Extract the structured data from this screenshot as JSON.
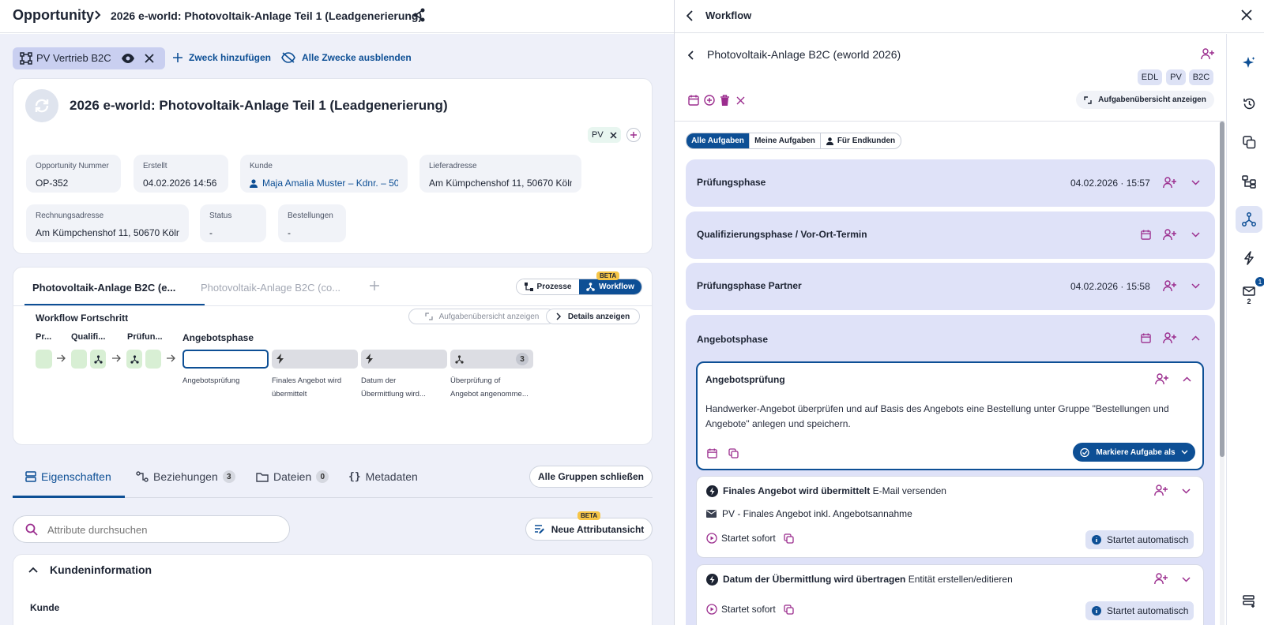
{
  "header": {
    "breadcrumb_root": "Opportunity",
    "breadcrumb_title": "2026 e-world: Photovoltaik-Anlage Teil 1 (Leadgenerierung)"
  },
  "purpose_bar": {
    "active_purpose": "PV Vertrieb B2C",
    "add_label": "Zweck hinzufügen",
    "hide_label": "Alle Zwecke ausblenden"
  },
  "opportunity": {
    "title": "2026 e-world: Photovoltaik-Anlage Teil 1 (Leadgenerierung)",
    "tag": "PV",
    "fields": [
      {
        "label": "Opportunity Nummer",
        "value": "OP-352"
      },
      {
        "label": "Erstellt",
        "value": "04.02.2026 14:56"
      },
      {
        "label": "Kunde",
        "value": "Maja Amalia Muster – Kdnr. – 50"
      },
      {
        "label": "Lieferadresse",
        "value": "Am Kümpchenshof 11, 50670 Köln"
      },
      {
        "label": "Rechnungsadresse",
        "value": "Am Kümpchenshof 11, 50670 Köln"
      },
      {
        "label": "Status",
        "value": "-"
      },
      {
        "label": "Bestellungen",
        "value": "-"
      }
    ]
  },
  "workflow_card": {
    "tab_active": "Photovoltaik-Anlage B2C (e...",
    "tab_inactive": "Photovoltaik-Anlage B2C (co...",
    "prozesse_label": "Prozesse",
    "workflow_label": "Workflow",
    "beta": "BETA",
    "progress_title": "Workflow Fortschritt",
    "aufgaben_btn": "Aufgabenübersicht anzeigen",
    "details_btn": "Details anzeigen",
    "phase_labels": [
      "Pr...",
      "Qualifi...",
      "Prüfun...",
      "Angebotsphase"
    ],
    "step_labels": [
      {
        "l1": "Angebotsprüfung",
        "l2": ""
      },
      {
        "l1": "Finales Angebot wird",
        "l2": "übermittelt"
      },
      {
        "l1": "Datum der",
        "l2": "Übermittlung wird..."
      },
      {
        "l1": "Überprüfung of",
        "l2": "Angebot angenomme..."
      }
    ],
    "step_count": "3"
  },
  "details_tabs": {
    "eigenschaften": "Eigenschaften",
    "beziehungen": "Beziehungen",
    "beziehungen_count": "3",
    "dateien": "Dateien",
    "dateien_count": "0",
    "metadaten": "Metadaten",
    "close_groups": "Alle Gruppen schließen"
  },
  "attributes": {
    "search_placeholder": "Attribute durchsuchen",
    "new_view": "Neue Attributansicht",
    "beta": "BETA",
    "group_title": "Kundeninformation",
    "first_field": "Kunde"
  },
  "workflow_panel": {
    "title": "Workflow",
    "process_title": "Photovoltaik-Anlage B2C (eworld 2026)",
    "tags": [
      "EDL",
      "PV",
      "B2C"
    ],
    "aufgaben_btn": "Aufgabenübersicht anzeigen",
    "filters": [
      "Alle Aufgaben",
      "Meine Aufgaben",
      "Für Endkunden"
    ],
    "phases": [
      {
        "title": "Prüfungsphase",
        "date": "04.02.2026 · 15:57"
      },
      {
        "title": "Qualifizierungsphase / Vor-Ort-Termin",
        "date": ""
      },
      {
        "title": "Prüfungsphase Partner",
        "date": "04.02.2026 · 15:58"
      },
      {
        "title": "Angebotsphase",
        "date": ""
      }
    ],
    "active_task": {
      "title": "Angebotsprüfung",
      "description_1": "Handwerker-Angebot überprüfen und auf Basis des Angebots eine Bestellung unter Gruppe \"Bestellungen und",
      "description_2": "Angebote\" anlegen und speichern.",
      "mark_btn": "Markiere Aufgabe als"
    },
    "tasks": [
      {
        "title": "Finales Angebot wird übermittelt",
        "suffix": "E-Mail versenden",
        "detail": "PV - Finales Angebot inkl. Angebotsannahme",
        "start": "Startet sofort",
        "auto": "Startet automatisch"
      },
      {
        "title": "Datum der Übermittlung wird übertragen",
        "suffix": "Entität erstellen/editieren",
        "start": "Startet sofort",
        "auto": "Startet automatisch"
      }
    ]
  },
  "sidebar": {
    "mail_badge": "1",
    "mail_count": "2"
  },
  "colors": {
    "primary": "#0d4f95",
    "accent_purple": "#9b2d8e",
    "phase_bg": "#dfe2f8",
    "left_bg": "#eef0f9"
  }
}
